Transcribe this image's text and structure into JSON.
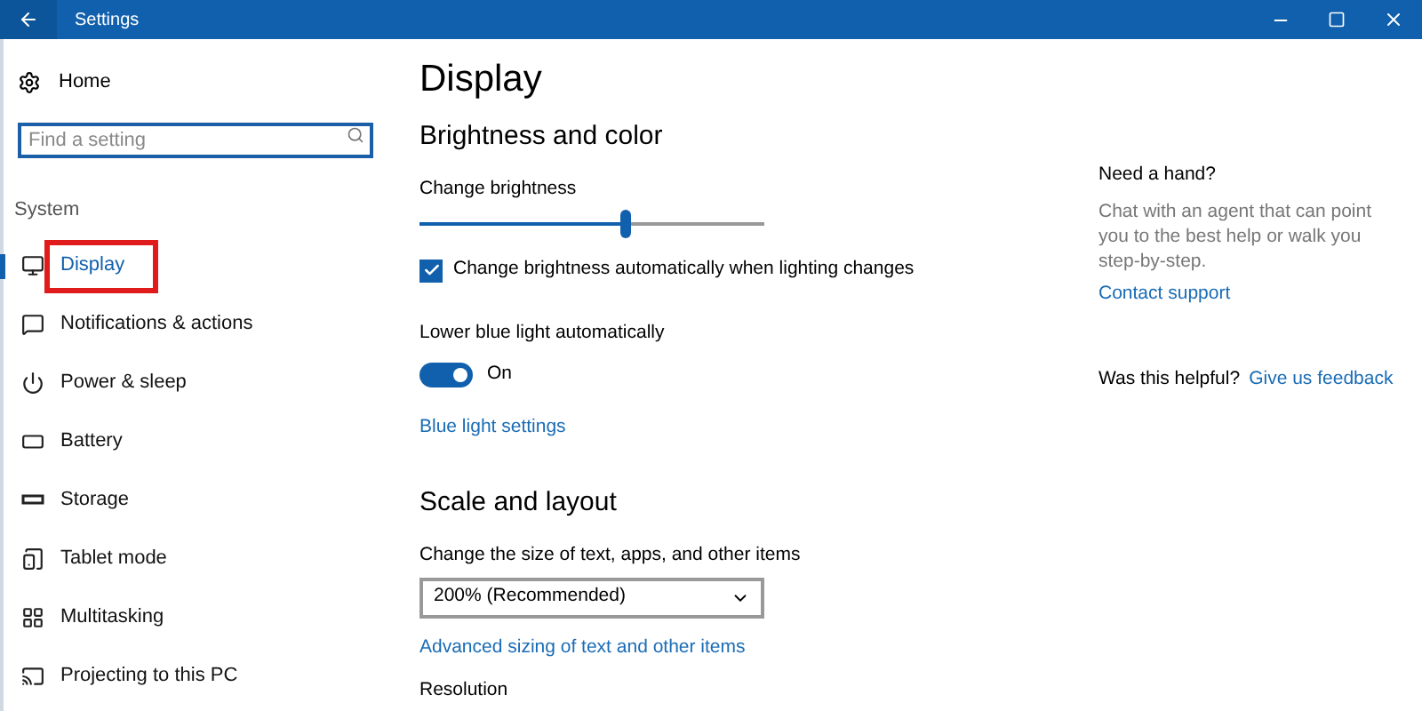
{
  "window": {
    "title": "Settings"
  },
  "sidebar": {
    "home": "Home",
    "search": {
      "placeholder": "Find a setting"
    },
    "section": "System",
    "items": [
      {
        "label": "Display",
        "selected": true,
        "highlighted": true
      },
      {
        "label": "Notifications & actions",
        "selected": false,
        "highlighted": false
      },
      {
        "label": "Power & sleep",
        "selected": false,
        "highlighted": false
      },
      {
        "label": "Battery",
        "selected": false,
        "highlighted": false
      },
      {
        "label": "Storage",
        "selected": false,
        "highlighted": false
      },
      {
        "label": "Tablet mode",
        "selected": false,
        "highlighted": false
      },
      {
        "label": "Multitasking",
        "selected": false,
        "highlighted": false
      },
      {
        "label": "Projecting to this PC",
        "selected": false,
        "highlighted": false
      }
    ]
  },
  "main": {
    "title": "Display",
    "brightness_section": "Brightness and color",
    "brightness_label": "Change brightness",
    "brightness": {
      "level": 0.6
    },
    "auto_brightness": {
      "label": "Change brightness automatically when lighting changes",
      "checked": true
    },
    "blue_light_label": "Lower blue light automatically",
    "blue_light": {
      "on": true,
      "state_text": "On"
    },
    "blue_light_link": "Blue light settings",
    "scale_section": "Scale and layout",
    "scale_label": "Change the size of text, apps, and other items",
    "scale_value": "200% (Recommended)",
    "advanced_link": "Advanced sizing of text and other items",
    "resolution_label": "Resolution"
  },
  "help": {
    "title": "Need a hand?",
    "text": "Chat with an agent that can point you to the best help or walk you step-by-step.",
    "link": "Contact support",
    "helpful": "Was this helpful?",
    "feedback": "Give us feedback"
  }
}
